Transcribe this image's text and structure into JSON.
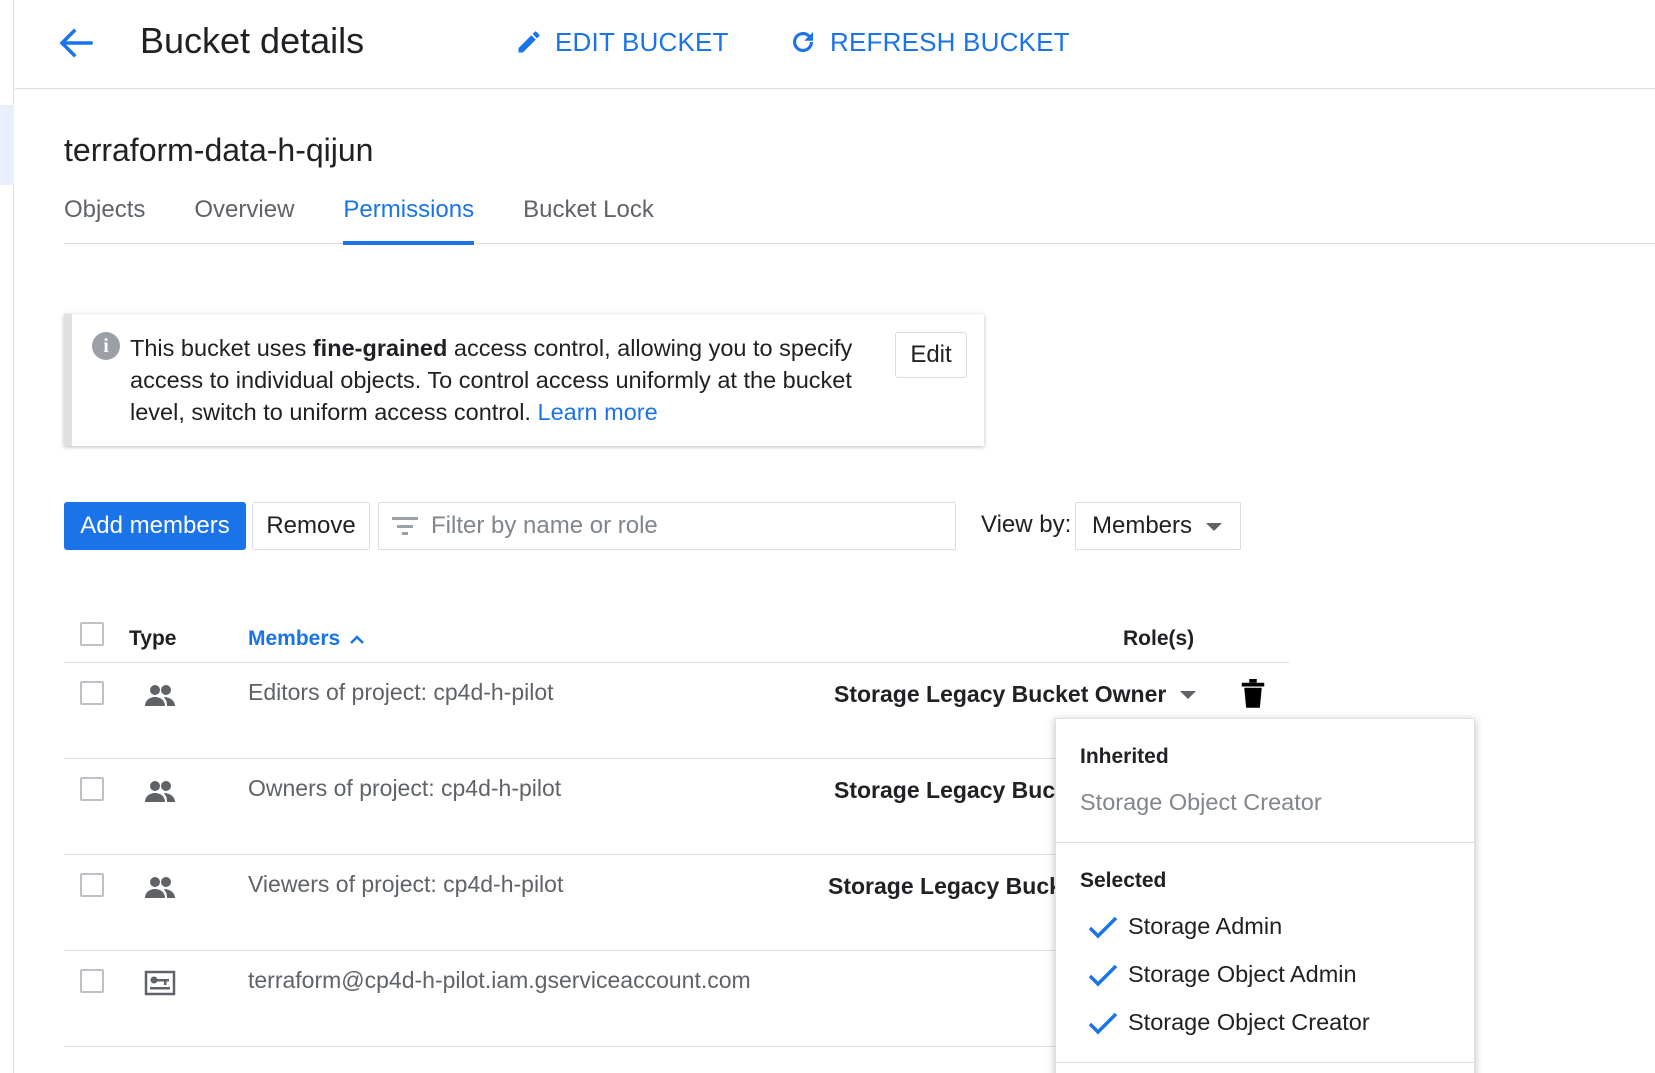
{
  "header": {
    "title": "Bucket details",
    "edit_label": "EDIT BUCKET",
    "refresh_label": "REFRESH BUCKET"
  },
  "bucket": {
    "name": "terraform-data-h-qijun"
  },
  "tabs": [
    {
      "label": "Objects",
      "active": false
    },
    {
      "label": "Overview",
      "active": false
    },
    {
      "label": "Permissions",
      "active": true
    },
    {
      "label": "Bucket Lock",
      "active": false
    }
  ],
  "info": {
    "text_before": "This bucket uses ",
    "bold": "fine-grained",
    "text_after": " access control, allowing you to specify access to individual objects. To control access uniformly at the bucket level, switch to uniform access control. ",
    "link": "Learn more",
    "edit_label": "Edit"
  },
  "toolbar": {
    "add_label": "Add members",
    "remove_label": "Remove",
    "filter_placeholder": "Filter by name or role",
    "viewby_label": "View by:",
    "viewby_value": "Members"
  },
  "table": {
    "headers": {
      "type": "Type",
      "members": "Members",
      "roles": "Role(s)"
    },
    "rows": [
      {
        "type": "group-icon",
        "member": "Editors of project: cp4d-h-pilot",
        "role": "Storage Legacy Bucket Owner"
      },
      {
        "type": "group-icon",
        "member": "Owners of project: cp4d-h-pilot",
        "role": "Storage Legacy Buck"
      },
      {
        "type": "group-icon",
        "member": "Viewers of project: cp4d-h-pilot",
        "role": "Storage Legacy Buck"
      },
      {
        "type": "service-account-icon",
        "member": "terraform@cp4d-h-pilot.iam.gserviceaccount.com",
        "role": ""
      }
    ]
  },
  "role_dropdown": {
    "inherited_heading": "Inherited",
    "inherited_items": [
      "Storage Object Creator"
    ],
    "selected_heading": "Selected",
    "selected_items": [
      "Storage Admin",
      "Storage Object Admin",
      "Storage Object Creator"
    ]
  },
  "colors": {
    "accent": "#1a73e8",
    "text": "#202124",
    "muted": "#5f6368",
    "border": "#dadce0"
  }
}
